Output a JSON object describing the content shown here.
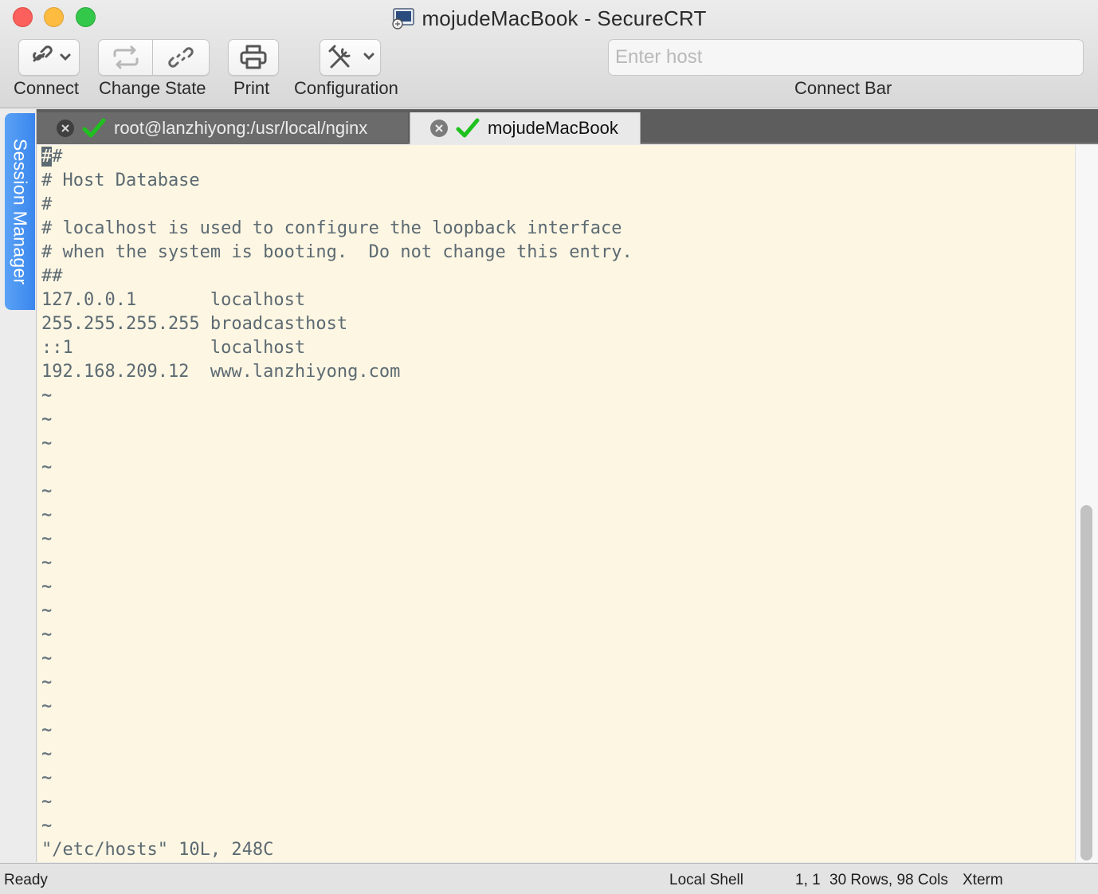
{
  "window": {
    "title": "mojudeMacBook - SecureCRT"
  },
  "toolbar": {
    "connect_label": "Connect",
    "change_state_label": "Change State",
    "print_label": "Print",
    "configuration_label": "Configuration",
    "connect_bar_label": "Connect Bar",
    "host_placeholder": "Enter host",
    "host_value": ""
  },
  "sidebar": {
    "session_manager_label": "Session Manager"
  },
  "tabs": [
    {
      "label": "root@lanzhiyong:/usr/local/nginx",
      "active": false,
      "status": "connected"
    },
    {
      "label": "mojudeMacBook",
      "active": true,
      "status": "connected"
    }
  ],
  "terminal": {
    "cursor_char": "#",
    "line1_rest": "#",
    "lines": [
      "# Host Database",
      "#",
      "# localhost is used to configure the loopback interface",
      "# when the system is booting.  Do not change this entry.",
      "##",
      "127.0.0.1       localhost",
      "255.255.255.255 broadcasthost",
      "::1             localhost",
      "192.168.209.12  www.lanzhiyong.com"
    ],
    "tilde": "~",
    "tilde_count": 19,
    "status_line": "\"/etc/hosts\" 10L, 248C"
  },
  "statusbar": {
    "ready": "Ready",
    "shell": "Local Shell",
    "position": "1, 1",
    "size": "30 Rows, 98 Cols",
    "emulation": "Xterm"
  },
  "colors": {
    "terminal_bg": "#fdf6e3",
    "terminal_fg": "#5c6a72",
    "session_tab": "#3a86ee",
    "check_green": "#1fc11f"
  }
}
